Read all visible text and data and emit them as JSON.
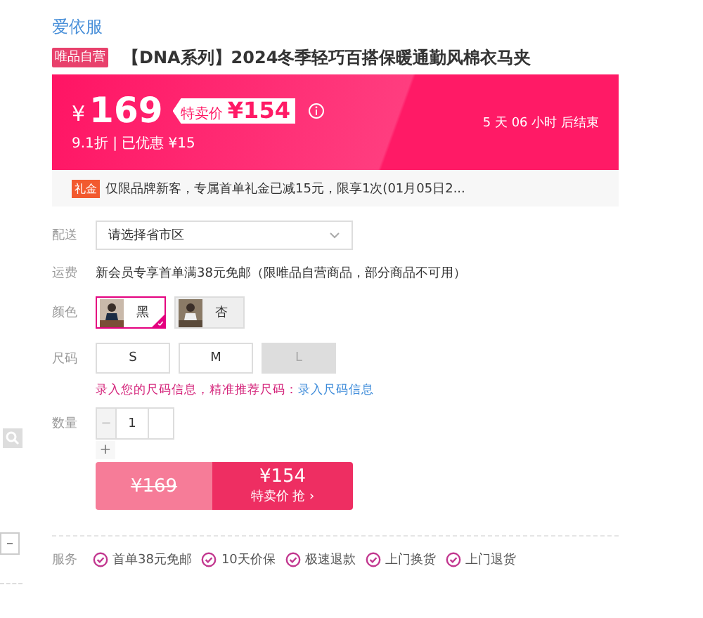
{
  "brand": "爱依服",
  "product": {
    "badge": "唯品自营",
    "title": "【DNA系列】2024冬季轻巧百搭保暖通勤风棉衣马夹"
  },
  "price": {
    "currency": "¥",
    "original": "169",
    "special_label": "特卖价",
    "special": "¥154",
    "discount": "9.1折 | 已优惠 ¥15",
    "countdown": "5  天 06  小时  后结束"
  },
  "notice": {
    "tag": "礼金",
    "text": "仅限品牌新客，专属首单礼金已减15元，限享1次(01月05日2..."
  },
  "delivery": {
    "label": "配送",
    "placeholder": "请选择省市区"
  },
  "shipping": {
    "label": "运费",
    "text": "新会员专享首单满38元免邮（限唯品自营商品，部分商品不可用）"
  },
  "colors": {
    "label": "颜色",
    "options": [
      {
        "name": "黑",
        "selected": true,
        "kind": "picture"
      },
      {
        "name": "杏",
        "selected": false,
        "kind": "picture"
      }
    ]
  },
  "sizes": {
    "label": "尺码",
    "options": [
      {
        "name": "S",
        "disabled": false
      },
      {
        "name": "M",
        "disabled": false
      },
      {
        "name": "L",
        "disabled": true
      }
    ]
  },
  "size_hint": {
    "text": "录入您的尺码信息，精准推荐尺码：",
    "link": "录入尺码信息"
  },
  "quantity": {
    "label": "数量",
    "minus": "−",
    "value": "1",
    "plus": "+"
  },
  "buy": {
    "original": "¥169",
    "price": "¥154",
    "action": "特卖价 抢 ›"
  },
  "services": {
    "label": "服务",
    "items": [
      "首单38元免邮",
      "10天价保",
      "极速退款",
      "上门换货",
      "上门退货"
    ]
  }
}
